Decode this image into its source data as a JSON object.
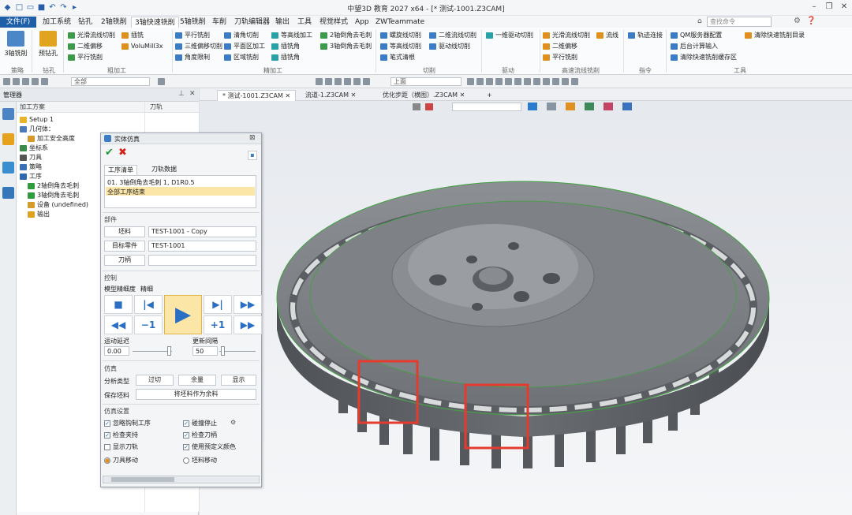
{
  "window": {
    "title": "中望3D 教育 2027 x64 - [* 测试-1001.Z3CAM]"
  },
  "menu": {
    "file": "文件(F)",
    "items": [
      "加工系统",
      "钻孔",
      "2轴铣削",
      "3轴快速铣削",
      "5轴铣削",
      "车削",
      "刀轨编辑器",
      "输出",
      "工具",
      "视觉样式",
      "App",
      "ZWTeammate"
    ],
    "search_placeholder": "查找命令"
  },
  "ribbon": {
    "big": [
      {
        "label": "3轴铣削"
      },
      {
        "label": "预钻孔"
      }
    ],
    "col_a": [
      "光滑流线切削",
      "二维偏移",
      "平行铣削"
    ],
    "col_b": [
      "插铣",
      "VoluMill3x"
    ],
    "col_c": [
      "平行铣削",
      "三维偏移切削",
      "角度限制"
    ],
    "col_d": [
      "清角切削",
      "平面区加工",
      "区域铣削"
    ],
    "col_e": [
      "等高线加工",
      "插铣角",
      "插铣角"
    ],
    "col_f": [
      "2轴倒角去毛刺",
      "3轴倒角去毛刺"
    ],
    "col_g": [
      "螺旋线切削",
      "等高线切削",
      "笔式清根"
    ],
    "col_h": [
      "二维流线切削",
      "驱动线切削"
    ],
    "col_i": [
      "一维驱动切削"
    ],
    "col_j": [
      "光滑流线切削",
      "二维偏移",
      "平行铣削"
    ],
    "col_k": [
      "流线"
    ],
    "col_l": [
      "轨迹连接"
    ],
    "col_m": [
      "QM服务器配置",
      "后台计算输入",
      "清除快速铣削缓存区"
    ],
    "col_n": [
      "清除快速铣削目录"
    ],
    "groups": [
      "策略",
      "钻孔",
      "粗加工",
      "精加工",
      "切削",
      "驱动",
      "高速流线铣削",
      "指令",
      "工具"
    ]
  },
  "toolbar": {
    "filter": "全部",
    "layer": "上面"
  },
  "panel": {
    "title": "管理器",
    "col_plan": "加工方案",
    "col_tool": "刀轨",
    "tree": [
      "Setup 1",
      "几何体：",
      "加工安全高度",
      "坐标系",
      "刀具",
      "策略",
      "工序",
      "2轴倒角去毛刺",
      "3轴倒角去毛刺",
      "设备 (undefined)",
      "输出"
    ]
  },
  "tabs": [
    "* 测试-1001.Z3CAM",
    "流道-1.Z3CAM",
    "优化步距（横图）.Z3CAM"
  ],
  "dialog": {
    "title": "实体仿真",
    "tab_ops": "工序清单",
    "tab_data": "刀轨数据",
    "op_line": "01. 3轴倒角去毛刺 1, D1R0.5",
    "op_selected": "全部工序结束",
    "sec_parts": "部件",
    "stock_btn": "坯料",
    "stock_val": "TEST-1001 - Copy",
    "target_btn": "目标零件",
    "target_val": "TEST-1001",
    "holder_btn": "刀柄",
    "holder_val": "",
    "sec_ctrl": "控制",
    "precision_label": "模型精细度",
    "precision_val": "精细",
    "motion_delay_label": "运动延迟",
    "motion_delay": "0.00",
    "update_label": "更新间隔",
    "update": "50",
    "sec_sim": "仿真",
    "analysis_label": "分析类型",
    "btn_overcut": "过切",
    "btn_residual": "余量",
    "btn_show": "显示",
    "save_stock_label": "保存坯料",
    "save_stock_btn": "将坯料作为余料",
    "sec_settings": "仿真设置",
    "cb1": "忽略钩制工序",
    "cb2": "碰撞停止",
    "cb3": "检查夹持",
    "cb4": "检查刀柄",
    "cb5": "显示刀轨",
    "cb6": "使用预定义颜色",
    "r1": "刀具移动",
    "r2": "坯料移动"
  }
}
